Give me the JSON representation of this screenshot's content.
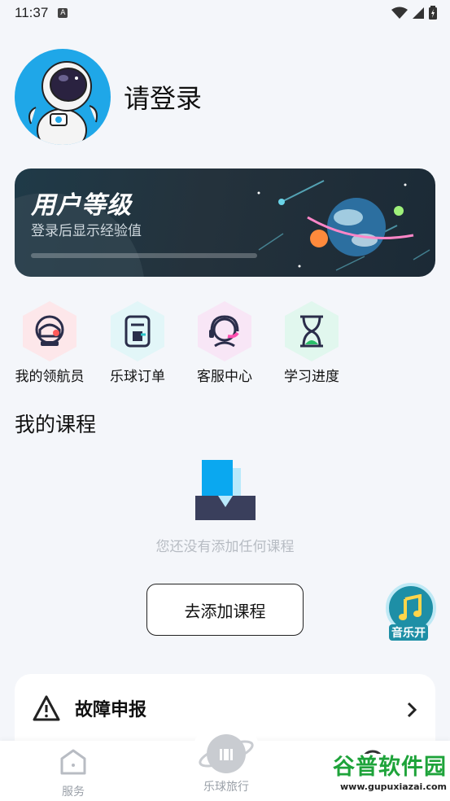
{
  "status_bar": {
    "time": "11:37",
    "notification_glyph": "A"
  },
  "profile": {
    "login_text": "请登录"
  },
  "level_card": {
    "title": "用户等级",
    "subtitle": "登录后显示经验值",
    "progress": 0
  },
  "quick_actions": [
    {
      "label": "我的领航员",
      "icon": "astronaut-helmet-icon",
      "color": "#fde7ea"
    },
    {
      "label": "乐球订单",
      "icon": "order-doc-icon",
      "color": "#e2f6f8"
    },
    {
      "label": "客服中心",
      "icon": "headset-icon",
      "color": "#f8e6f6"
    },
    {
      "label": "学习进度",
      "icon": "hourglass-icon",
      "color": "#e1f7ee"
    }
  ],
  "courses": {
    "section_title": "我的课程",
    "empty_text": "您还没有添加任何课程",
    "add_button": "去添加课程"
  },
  "music_fab": {
    "label": "音乐开"
  },
  "fault_report": {
    "label": "故障申报"
  },
  "tab_bar": {
    "tabs": [
      {
        "label": "服务"
      },
      {
        "label": "乐球旅行"
      }
    ]
  },
  "watermark": {
    "top": "谷普软件园",
    "bottom": "www.gupuxiazai.com"
  },
  "colors": {
    "accent": "#1fa7e8",
    "card_dark": "#24323c",
    "empty_text": "#b7bcc3"
  }
}
